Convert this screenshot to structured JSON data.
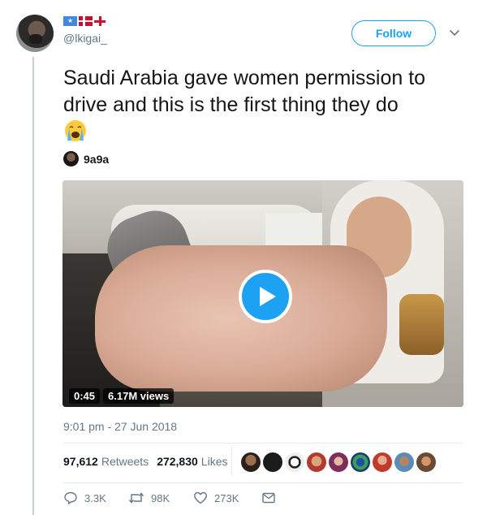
{
  "user": {
    "handle": "@lkigai_",
    "flags": [
      "somalia-flag",
      "denmark-flag",
      "england-flag"
    ]
  },
  "header": {
    "follow_label": "Follow",
    "menu_icon": "chevron-down-icon"
  },
  "tweet": {
    "text": "Saudi Arabia gave women permission to drive and this is the first thing they do",
    "emoji": "loudly-crying-face-emoji"
  },
  "media": {
    "author_name": "9a9a",
    "duration": "0:45",
    "views": "6.17M views",
    "play_icon": "play-icon"
  },
  "timestamp": "9:01 pm - 27 Jun 2018",
  "stats": {
    "retweets_count": "97,612",
    "retweets_label": "Retweets",
    "likes_count": "272,830",
    "likes_label": "Likes",
    "liker_avatar_count": 9
  },
  "actions": {
    "reply_count": "3.3K",
    "retweet_count": "98K",
    "like_count": "273K"
  },
  "colors": {
    "accent": "#1da1f2",
    "text": "#14171a",
    "muted": "#657786",
    "border": "#e6ecf0"
  }
}
